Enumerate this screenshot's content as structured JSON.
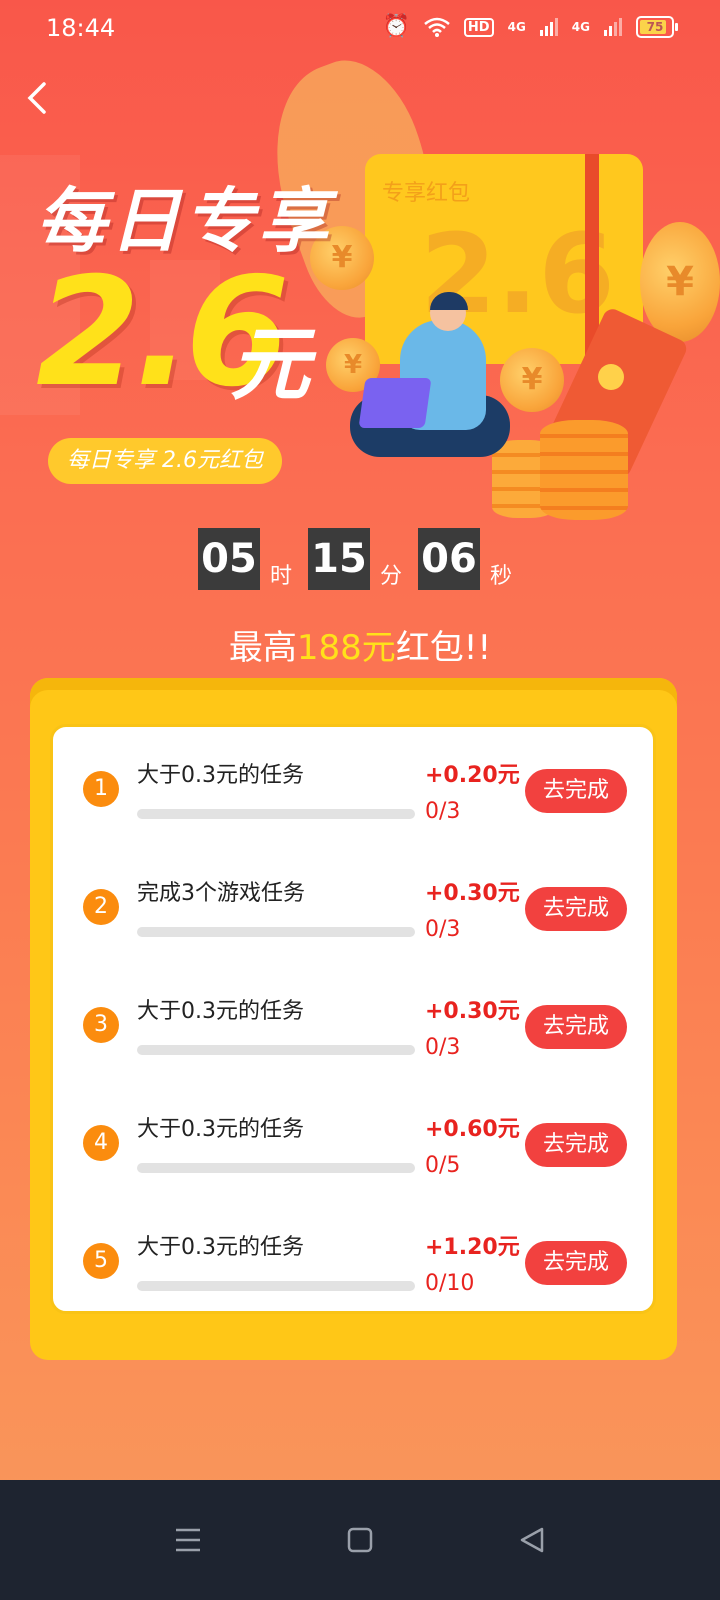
{
  "status_bar": {
    "time": "18:44",
    "hd": "HD",
    "net1": "4G",
    "net2": "4G",
    "battery": "75"
  },
  "hero": {
    "title": "每日专享",
    "amount": "2.6",
    "unit": "元",
    "pill": "每日专享 2.6元红包",
    "card_label": "专享红包",
    "card_number": "2.6",
    "currency": "¥"
  },
  "countdown": {
    "hours": "05",
    "hours_unit": "时",
    "minutes": "15",
    "minutes_unit": "分",
    "seconds": "06",
    "seconds_unit": "秒"
  },
  "promo": {
    "prefix": "最高",
    "highlight": "188元",
    "suffix": "红包!!"
  },
  "tasks": [
    {
      "index": "1",
      "title": "大于0.3元的任务",
      "reward": "+0.20元",
      "progress": "0/3",
      "progress_fraction": 0,
      "button": "去完成"
    },
    {
      "index": "2",
      "title": "完成3个游戏任务",
      "reward": "+0.30元",
      "progress": "0/3",
      "progress_fraction": 0,
      "button": "去完成"
    },
    {
      "index": "3",
      "title": "大于0.3元的任务",
      "reward": "+0.30元",
      "progress": "0/3",
      "progress_fraction": 0,
      "button": "去完成"
    },
    {
      "index": "4",
      "title": "大于0.3元的任务",
      "reward": "+0.60元",
      "progress": "0/5",
      "progress_fraction": 0,
      "button": "去完成"
    },
    {
      "index": "5",
      "title": "大于0.3元的任务",
      "reward": "+1.20元",
      "progress": "0/10",
      "progress_fraction": 0,
      "button": "去完成"
    }
  ],
  "colors": {
    "accent_red": "#f2413f",
    "accent_orange": "#fb8c0e",
    "panel_yellow": "#ffc717",
    "highlight_yellow": "#ffe11a"
  },
  "icons": {
    "back": "chevron-left-icon",
    "alarm": "alarm-icon",
    "wifi": "wifi-icon",
    "nav_menu": "menu-icon",
    "nav_home": "home-square-icon",
    "nav_back": "back-triangle-icon"
  }
}
